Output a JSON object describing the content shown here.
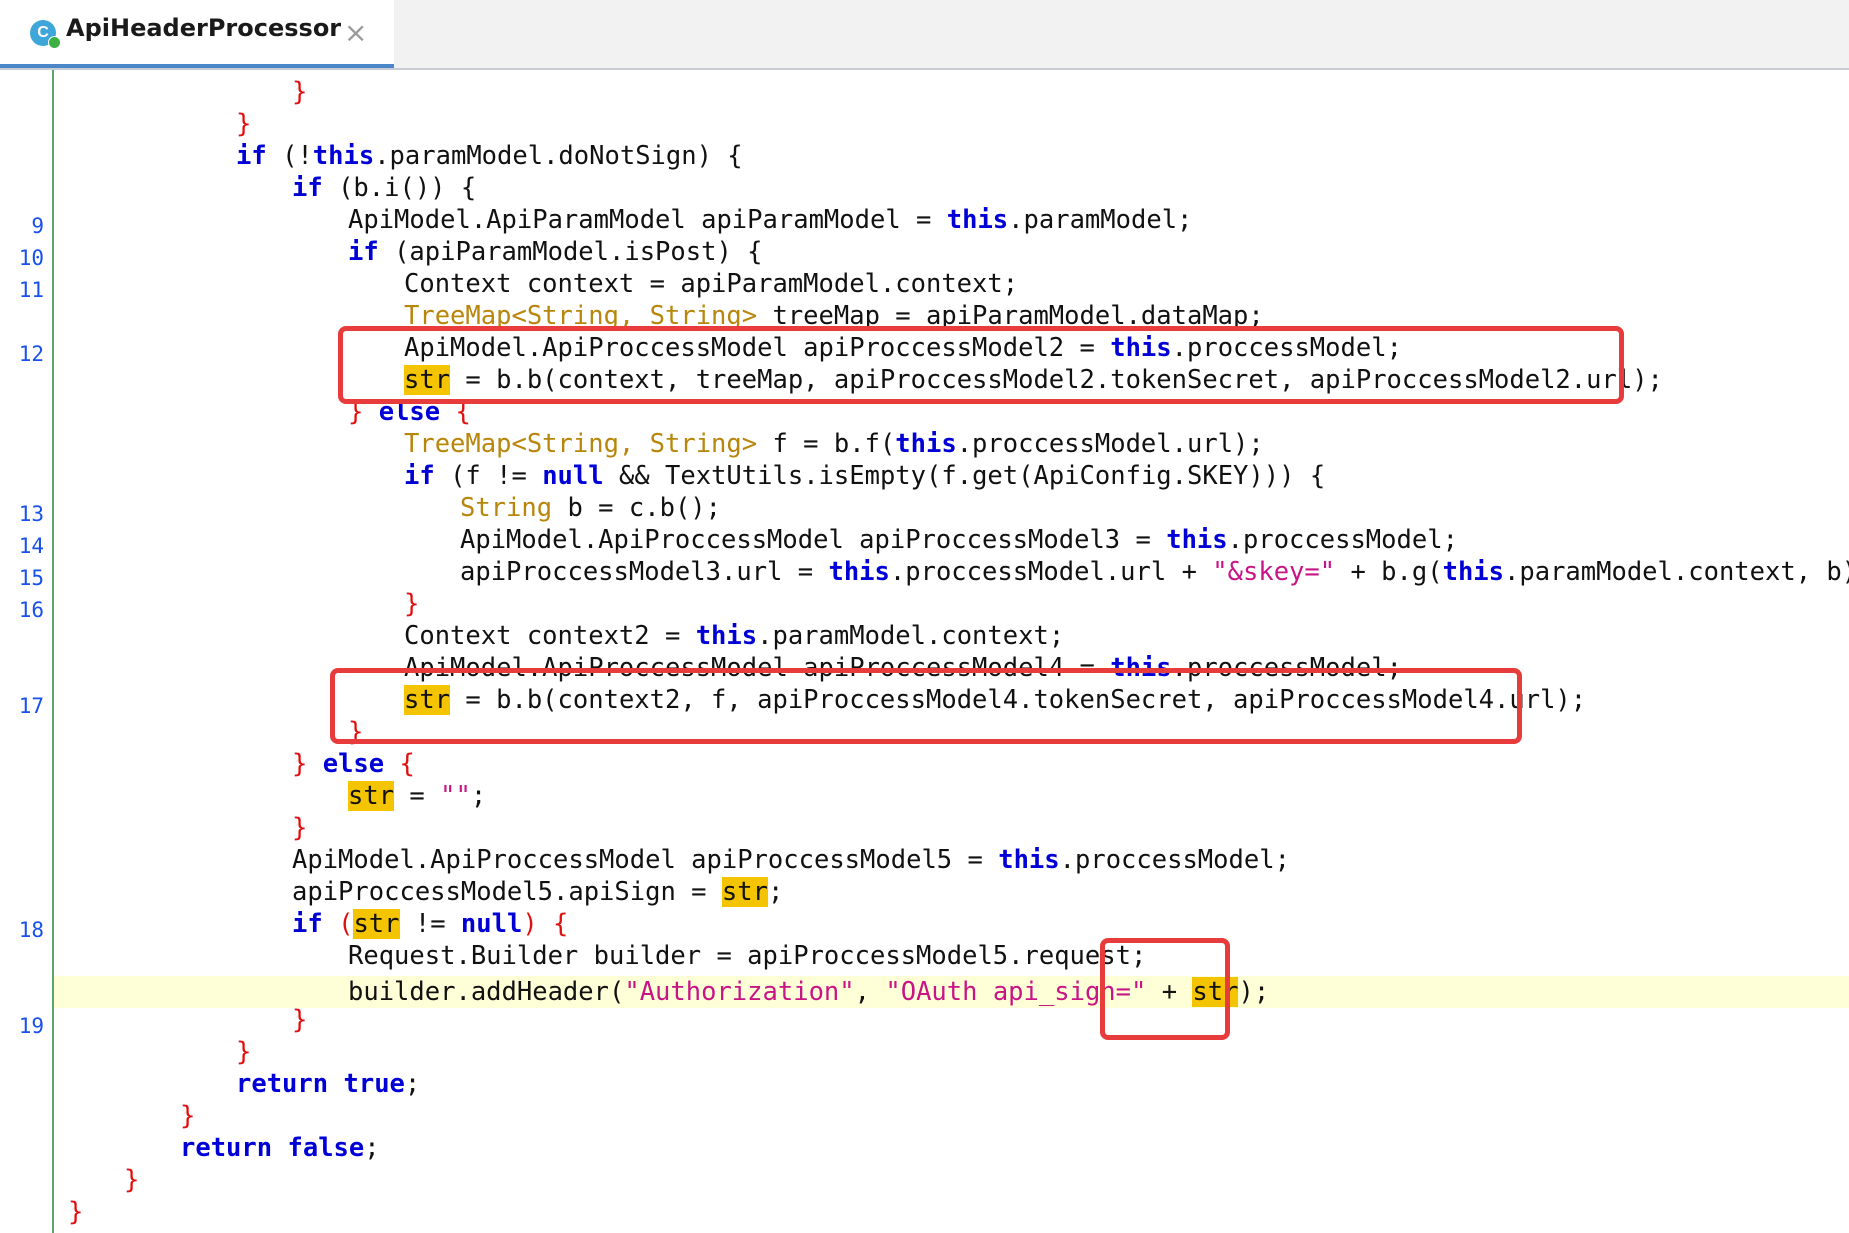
{
  "tab": {
    "title": "ApiHeaderProcessor",
    "icon_letter": "C",
    "close_glyph": "×"
  },
  "line_numbers": [
    "9",
    "10",
    "11",
    "12",
    "13",
    "14",
    "15",
    "16",
    "17",
    "18",
    "19"
  ],
  "code": {
    "l0": "}",
    "l1": "}",
    "l2a": "if",
    "l2b": " (!",
    "l2c": "this",
    "l2d": ".paramModel.doNotSign) {",
    "l3a": "if",
    "l3b": " (b.i()) {",
    "l4a": "ApiModel.ApiParamModel apiParamModel = ",
    "l4b": "this",
    "l4c": ".paramModel;",
    "l5a": "if",
    "l5b": " (apiParamModel.isPost) {",
    "l6": "Context context = apiParamModel.context;",
    "l7a": "TreeMap<String, String>",
    "l7b": " treeMap = apiParamModel.dataMap;",
    "l8a": "ApiModel.ApiProccessModel apiProccessModel2 = ",
    "l8b": "this",
    "l8c": ".proccessModel;",
    "l9a": "str",
    "l9b": " = b.b(context, treeMap, apiProccessModel2.tokenSecret, apiProccessModel2.url);",
    "l10a": "} ",
    "l10b": "else",
    "l10c": " {",
    "l11a": "TreeMap<String, String>",
    "l11b": " f = b.f(",
    "l11c": "this",
    "l11d": ".proccessModel.url);",
    "l12a": "if",
    "l12b": " (f != ",
    "l12c": "null",
    "l12d": " && TextUtils.isEmpty(f.get(ApiConfig.SKEY))) {",
    "l13a": "String",
    "l13b": " b = c.b();",
    "l14a": "ApiModel.ApiProccessModel apiProccessModel3 = ",
    "l14b": "this",
    "l14c": ".proccessModel;",
    "l15a": "apiProccessModel3.url = ",
    "l15b": "this",
    "l15c": ".proccessModel.url + ",
    "l15d": "\"&skey=\"",
    "l15e": " + b.g(",
    "l15f": "this",
    "l15g": ".paramModel.context, b);",
    "l16": "}",
    "l17a": "Context context2 = ",
    "l17b": "this",
    "l17c": ".paramModel.context;",
    "l18a": "ApiModel.ApiProccessModel apiProccessModel4 = ",
    "l18b": "this",
    "l18c": ".proccessModel;",
    "l19a": "str",
    "l19b": " = b.b(context2, f, apiProccessModel4.tokenSecret, apiProccessModel4.url);",
    "l20": "}",
    "l21a": "} ",
    "l21b": "else",
    "l21c": " {",
    "l22a": "str",
    "l22b": " = ",
    "l22c": "\"\"",
    "l22d": ";",
    "l23": "}",
    "l24a": "ApiModel.ApiProccessModel apiProccessModel5 = ",
    "l24b": "this",
    "l24c": ".proccessModel;",
    "l25a": "apiProccessModel5.apiSign = ",
    "l25b": "str",
    "l25c": ";",
    "l26a": "if",
    "l26b": " (",
    "l26c": "str",
    "l26d": " != ",
    "l26e": "null",
    "l26f": ") {",
    "l27": "Request.Builder builder = apiProccessModel5.request;",
    "l28a": "builder.addHeader(",
    "l28b": "\"Authorization\"",
    "l28c": ", ",
    "l28d": "\"OAuth api_sign=\"",
    "l28e": " + ",
    "l28f": "str",
    "l28g": ");",
    "l29": "}",
    "l30": "}",
    "l31a": "return",
    "l31b": " ",
    "l31c": "true",
    "l31d": ";",
    "l32": "}",
    "l33a": "return",
    "l33b": " ",
    "l33c": "false",
    "l33d": ";",
    "l34": "}",
    "l35": "}"
  },
  "colors": {
    "keyword": "#0000d6",
    "brace": "#e01010",
    "type": "#b8860b",
    "string": "#c71585",
    "highlight": "#f5c400",
    "annotation_box": "#e83b3b",
    "caret_line": "#ffffd7"
  }
}
